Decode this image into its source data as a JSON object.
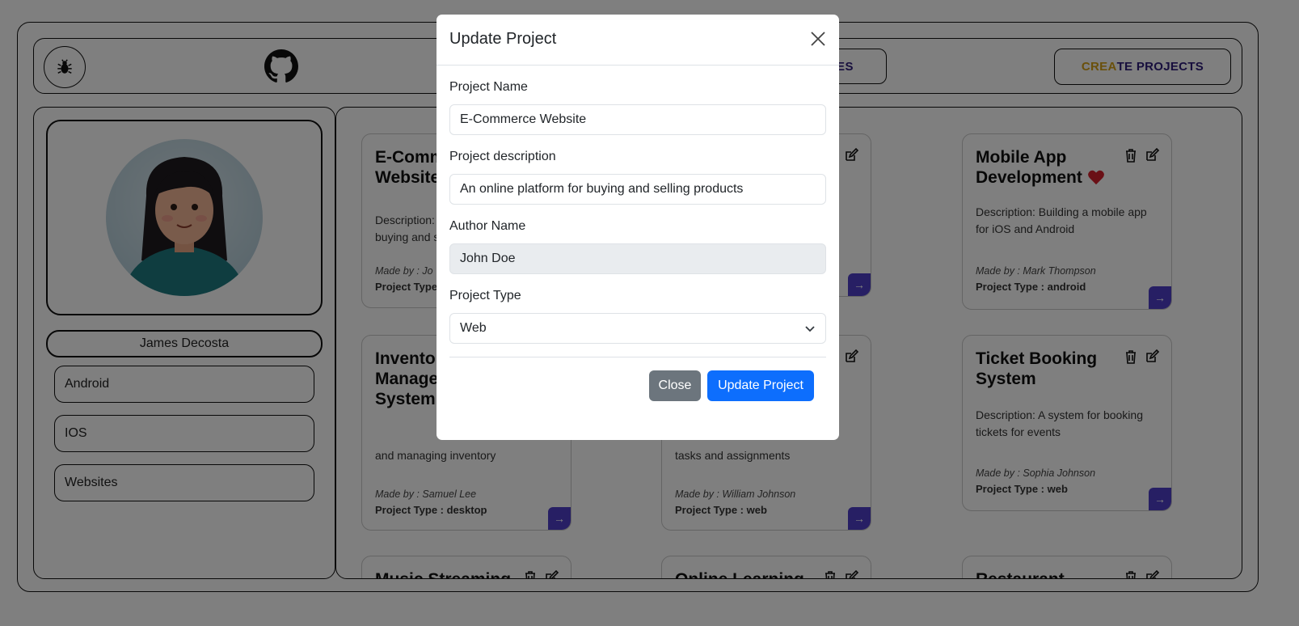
{
  "topbar": {
    "bug_icon": "bug-icon",
    "github_icon": "github-icon",
    "nav_partial_label": "ES",
    "create_label_part1": "CREA",
    "create_label_part2": "TE PROJECTS"
  },
  "sidebar": {
    "username": "James Decosta",
    "items": [
      {
        "label": "Android"
      },
      {
        "label": "IOS"
      },
      {
        "label": "Websites"
      }
    ]
  },
  "cards": [
    {
      "title": "E-Comm\nWebsite",
      "desc": "Description:\nbuying and s",
      "by": "Made by : Jo",
      "type": "Project Type"
    },
    {
      "title": "Mobile App Development",
      "desc": "Description: Building a mobile app for iOS and Android",
      "by": "Made by : Mark Thompson",
      "type": "Project Type : android"
    },
    {
      "title": "Inventory Management System",
      "desc": "and managing inventory",
      "by": "Made by : Samuel Lee",
      "type": "Project Type : desktop"
    },
    {
      "title": "",
      "desc": "tasks and assignments",
      "by": "Made by : William Johnson",
      "type": "Project Type : web"
    },
    {
      "title": "Ticket Booking System",
      "desc": "Description: A system for booking tickets for events",
      "by": "Made by : Sophia Johnson",
      "type": "Project Type : web"
    },
    {
      "title": "Music Streaming"
    },
    {
      "title": "Online Learning"
    },
    {
      "title": "Restaurant"
    }
  ],
  "modal": {
    "title": "Update Project",
    "fields": {
      "project_name": {
        "label": "Project Name",
        "value": "E-Commerce Website"
      },
      "project_description": {
        "label": "Project description",
        "value": "An online platform for buying and selling products"
      },
      "author_name": {
        "label": "Author Name",
        "value": "John Doe"
      },
      "project_type": {
        "label": "Project Type",
        "value": "Web"
      }
    },
    "close_label": "Close",
    "update_label": "Update Project"
  },
  "colors": {
    "primary": "#0d6efd",
    "secondary": "#6c757d",
    "card_arrow": "#4f3fc9",
    "create_accent": "#d4a017",
    "heart": "#d4202c"
  }
}
